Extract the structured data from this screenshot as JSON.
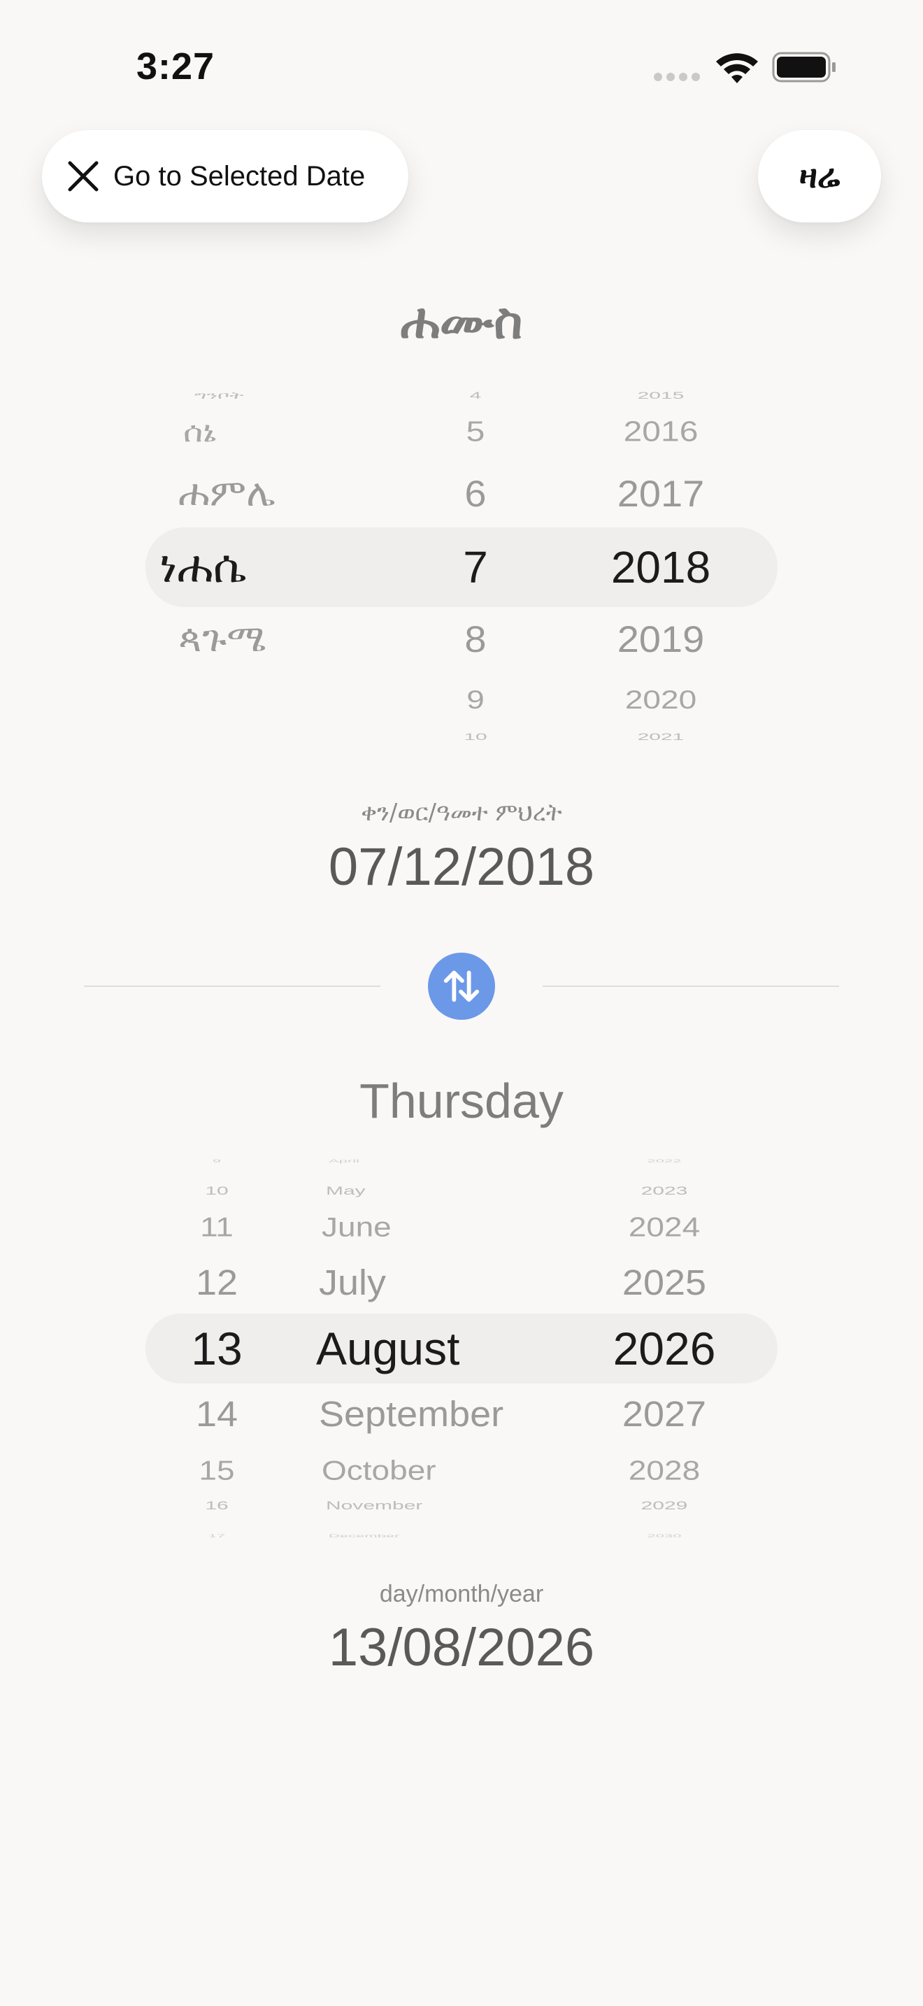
{
  "status_bar": {
    "time": "3:27"
  },
  "top_bar": {
    "goto_label": "Go to Selected Date",
    "today_label": "ዛሬ"
  },
  "ethiopian": {
    "weekday": "ሐሙስ",
    "months": [
      "ግንቦት",
      "ሰኔ",
      "ሐምሌ",
      "ነሐሴ",
      "ጳጉሜ"
    ],
    "days": [
      "4",
      "5",
      "6",
      "7",
      "8",
      "9",
      "10"
    ],
    "years": [
      "2015",
      "2016",
      "2017",
      "2018",
      "2019",
      "2020",
      "2021"
    ],
    "selected": {
      "month": "ነሐሴ",
      "day": "7",
      "year": "2018"
    },
    "format_label": "ቀን/ወር/ዓመተ ምህረት",
    "date_value": "07/12/2018"
  },
  "gregorian": {
    "weekday": "Thursday",
    "days": [
      "9",
      "10",
      "11",
      "12",
      "13",
      "14",
      "15",
      "16",
      "17"
    ],
    "months": [
      "April",
      "May",
      "June",
      "July",
      "August",
      "September",
      "October",
      "November",
      "December"
    ],
    "years": [
      "2022",
      "2023",
      "2024",
      "2025",
      "2026",
      "2027",
      "2028",
      "2029",
      "2030"
    ],
    "selected": {
      "day": "13",
      "month": "August",
      "year": "2026"
    },
    "format_label": "day/month/year",
    "date_value": "13/08/2026"
  },
  "colors": {
    "accent": "#6c98e8",
    "background": "#f9f8f6",
    "selection_band": "#efeeec",
    "selected_text": "#1b1b1b",
    "muted_text": "#8a8a8a"
  },
  "icons": {
    "close": "close-icon",
    "swap": "swap-vertical-icon",
    "wifi": "wifi-icon",
    "battery": "battery-icon",
    "cellular": "cellular-signal-icon"
  }
}
